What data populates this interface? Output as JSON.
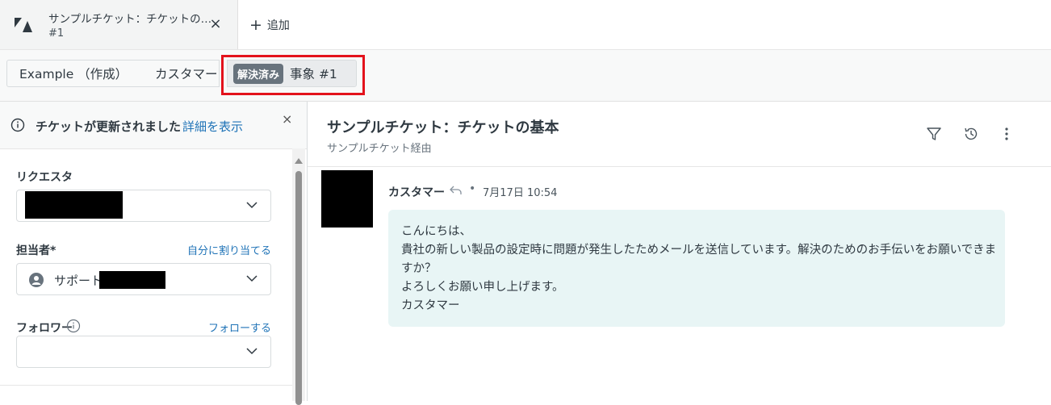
{
  "tabs": {
    "ticket_tab_title": "サンプルチケット：チケットの…",
    "ticket_tab_id": "#1",
    "close_symbol": "×",
    "add_label": "追加"
  },
  "breadcrumb": {
    "organization": "Example （作成）",
    "requester": "カスタマー",
    "status_badge": "解決済み",
    "ticket": "事象 #1"
  },
  "notice": {
    "message": "チケットが更新されました",
    "link": "詳細を表示",
    "close_symbol": "×"
  },
  "fields": {
    "requester_label": "リクエスタ",
    "assignee_label": "担当者*",
    "assign_to_me": "自分に割り当てる",
    "assignee_value": "サポート/",
    "followers_label": "フォロワー",
    "follow_link": "フォローする"
  },
  "conversation": {
    "title": "サンプルチケット：チケットの基本",
    "subtitle": "サンプルチケット経由",
    "author": "カスタマー",
    "separator": "•",
    "timestamp": "7月17日 10:54",
    "body_line1": "こんにちは、",
    "body_line2": "貴社の新しい製品の設定時に問題が発生したためメールを送信しています。解決のためのお手伝いをお願いできますか？",
    "body_line3": "よろしくお願い申し上げます。",
    "body_line4": "カスタマー"
  },
  "colors": {
    "accent_link": "#1f73b7",
    "status_badge_bg": "#68737d",
    "highlight_border": "#e3121c",
    "message_bubble_bg": "#e8f5f5"
  },
  "icons": {
    "logo": "zendesk-logo-icon",
    "close": "close-icon",
    "add": "plus-icon",
    "info": "info-icon",
    "chevron": "chevron-down-icon",
    "avatar": "user-avatar-icon",
    "filter": "filter-icon",
    "history": "history-icon",
    "more": "more-vertical-icon",
    "reply": "reply-icon"
  }
}
